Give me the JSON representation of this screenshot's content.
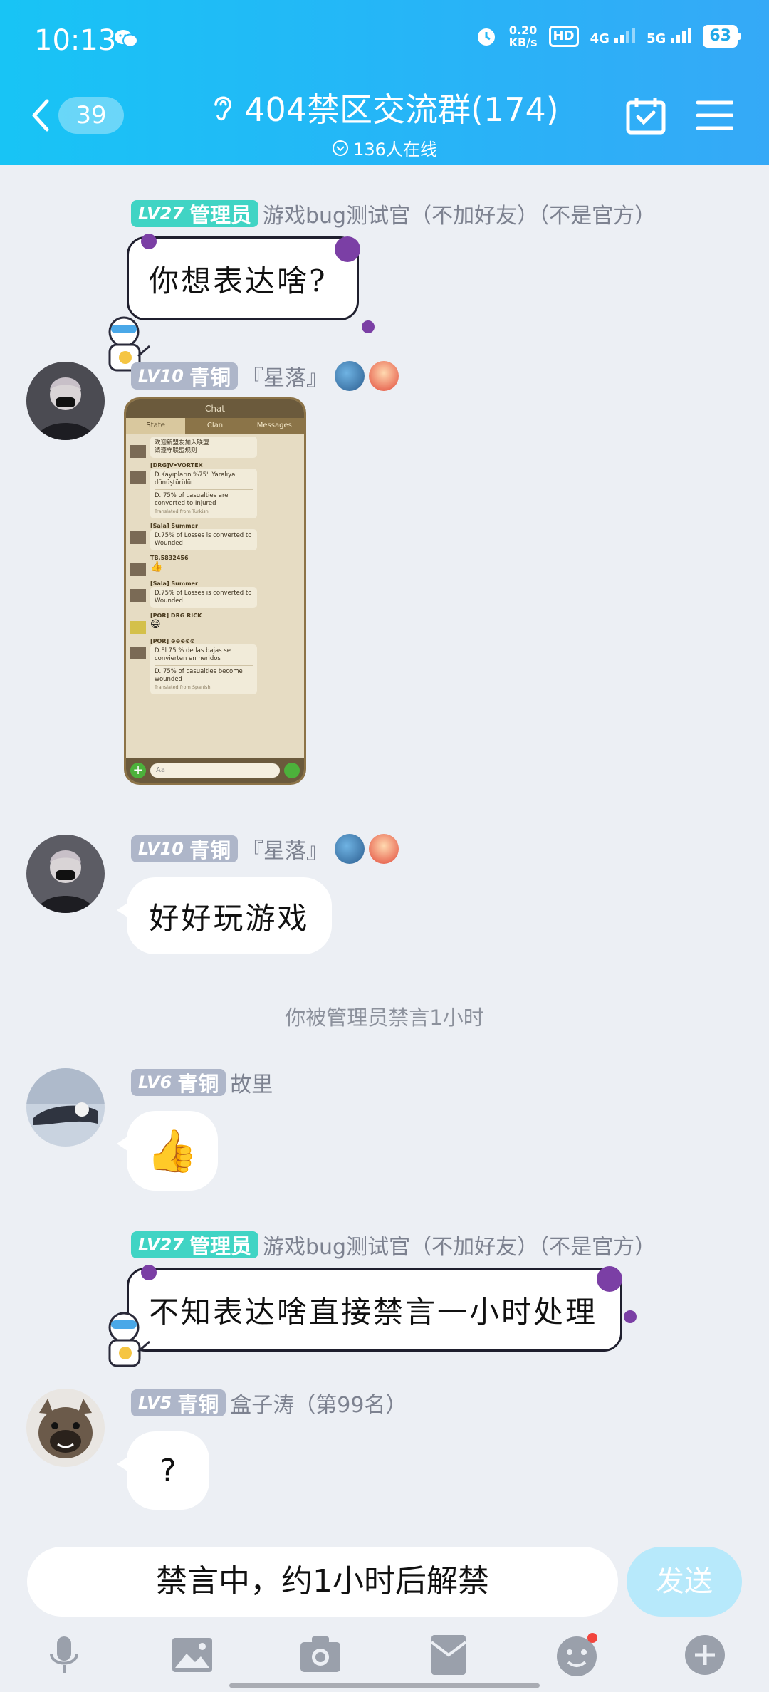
{
  "status_bar": {
    "time": "10:13",
    "net_speed_value": "0.20",
    "net_speed_unit": "KB/s",
    "hd_label": "HD",
    "sim1": "4G",
    "sim2": "5G",
    "battery": "63"
  },
  "nav": {
    "back_count": "39",
    "group_title": "404禁区交流群(174)",
    "online_text": "136人在线"
  },
  "messages": [
    {
      "level": "LV27",
      "role": "管理员",
      "name": "游戏bug测试官（不加好友）（不是官方）",
      "text": "你想表达啥?"
    },
    {
      "level": "LV10",
      "role": "青铜",
      "name": "『星落』",
      "image": {
        "header_title": "Chat",
        "tabs": [
          "State",
          "Clan",
          "Messages"
        ],
        "rows": [
          {
            "name": "",
            "lines": [
              "欢迎新盟友加入联盟",
              "请遵守联盟规则"
            ]
          },
          {
            "name": "[DRG]V•VORTEX",
            "lines": [
              "D.Kayıpların %75'i Yaralıya dönüştürülür",
              "D. 75% of casualties are converted to Injured",
              "Translated from Turkish"
            ]
          },
          {
            "name": "[Sala] Summer",
            "lines": [
              "D.75% of Losses is converted to Wounded"
            ]
          },
          {
            "name": "TB.5832456",
            "lines": []
          },
          {
            "name": "[Sala] Summer",
            "lines": [
              "D.75% of Losses is converted to Wounded"
            ]
          },
          {
            "name": "[POR] DRG RICK",
            "lines": []
          },
          {
            "name": "[POR] ⊙⊙⊙⊙⊙",
            "lines": [
              "D.El 75 % de las bajas se convierten en heridos",
              "D. 75% of casualties become wounded",
              "Translated from Spanish"
            ]
          }
        ],
        "input_placeholder": "Aa"
      }
    },
    {
      "level": "LV10",
      "role": "青铜",
      "name": "『星落』",
      "text": "好好玩游戏"
    },
    {
      "system": "你被管理员禁言1小时"
    },
    {
      "level": "LV6",
      "role": "青铜",
      "name": "故里",
      "emoji": "👍"
    },
    {
      "level": "LV27",
      "role": "管理员",
      "name": "游戏bug测试官（不加好友）（不是官方）",
      "text": "不知表达啥直接禁言一小时处理"
    },
    {
      "level": "LV5",
      "role": "青铜",
      "name": "盒子涛（第99名）",
      "text": "?"
    }
  ],
  "input": {
    "muted_text": "禁言中，约1小时后解禁",
    "send_label": "发送"
  },
  "colors": {
    "header_start": "#18c4f5",
    "header_end": "#35a9f7",
    "admin_badge": "#40d4c4",
    "bronze_badge": "#aeb6c9",
    "send_disabled": "#b7e9fb"
  }
}
